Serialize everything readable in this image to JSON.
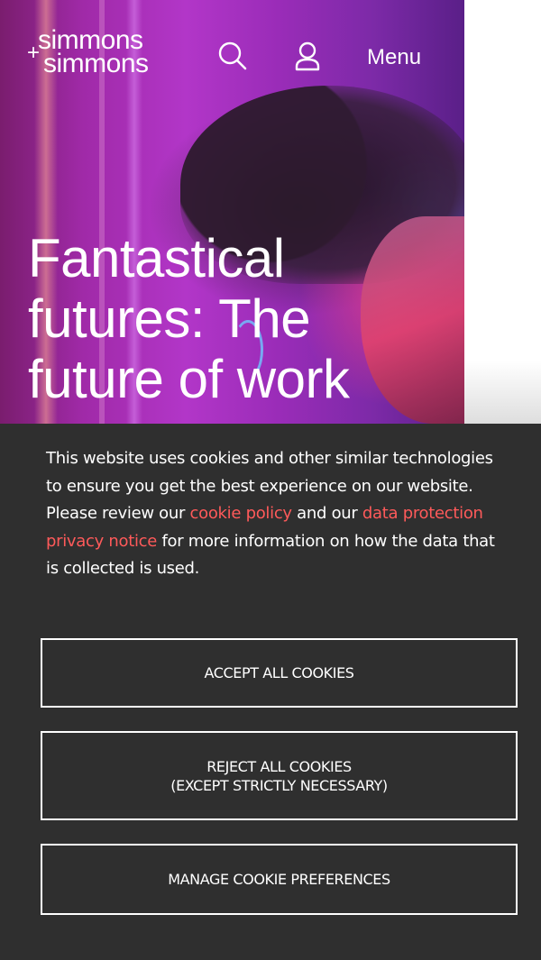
{
  "header": {
    "logo_line1": "simmons",
    "logo_plus": "+",
    "logo_line2": "simmons",
    "menu_label": "Menu"
  },
  "hero": {
    "title": "Fantastical futures: The future of work"
  },
  "cookie_banner": {
    "text_1": "This website uses cookies and other similar technologies to ensure you get the best experience on our website. Please review our ",
    "link_cookie_policy": "cookie policy",
    "text_2": " and our ",
    "link_privacy_notice": "data protection privacy notice",
    "text_3": " for more information on how the data that is collected is used.",
    "accept_label": "ACCEPT ALL COOKIES",
    "reject_label_line1": "REJECT ALL COOKIES",
    "reject_label_line2": "(EXCEPT STRICTLY NECESSARY)",
    "manage_label": "MANAGE COOKIE PREFERENCES"
  },
  "colors": {
    "banner_bg": "#2f2f2f",
    "link": "#ff5a5a",
    "text": "#ffffff"
  },
  "icons": [
    "search-icon",
    "user-icon"
  ]
}
